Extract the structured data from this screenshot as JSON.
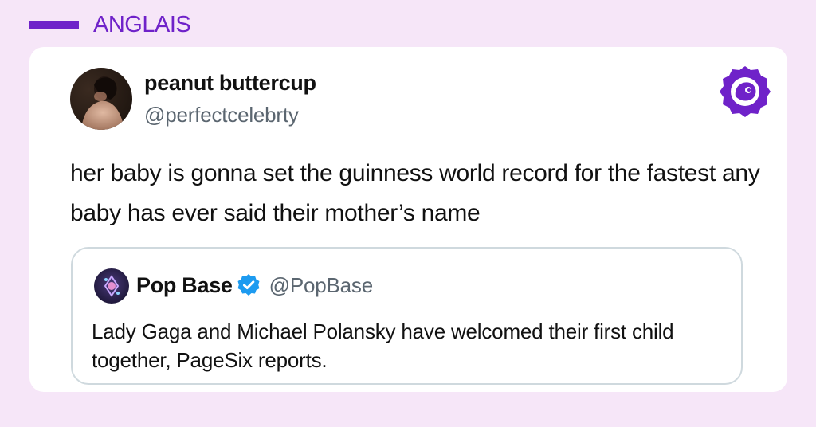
{
  "header": {
    "language_label": "ANGLAIS",
    "accent_color": "#6f22c9",
    "background_color": "#f6e6f8"
  },
  "tweet": {
    "display_name": "peanut buttercup",
    "handle": "@perfectcelebrty",
    "avatar_icon": "user-avatar-photo",
    "text": "her baby is gonna set the guinness world record for the fastest any baby has ever said their mother’s name",
    "brand_icon": "bird-face-logo-icon"
  },
  "quoted_tweet": {
    "display_name": "Pop Base",
    "verified_icon": "verified-badge-icon",
    "verified_color": "#1d9bf0",
    "handle": "@PopBase",
    "avatar_icon": "pop-base-avatar",
    "text": "Lady Gaga and Michael Polansky have welcomed their first child together, PageSix reports."
  }
}
